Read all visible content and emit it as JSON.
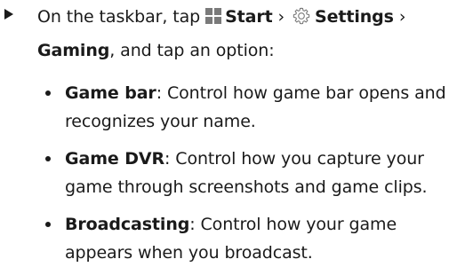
{
  "step": {
    "prefix": "On the taskbar, tap",
    "start_label": "Start",
    "separator1": " › ",
    "settings_label": "Settings",
    "separator2": " ›",
    "gaming_label": "Gaming",
    "suffix": ", and tap an option:"
  },
  "options": [
    {
      "name": "Game bar",
      "separator": ": ",
      "description": "Control how game bar opens and recognizes your name."
    },
    {
      "name": "Game DVR",
      "separator": ": ",
      "description": "Control how you capture your game through screenshots and game clips."
    },
    {
      "name": "Broadcasting",
      "separator": ": ",
      "description": "Control how your game appears when you broadcast."
    }
  ],
  "colors": {
    "text": "#1a1a1a",
    "icon": "#7a7a7a"
  },
  "icons": {
    "step_marker": "triangle-arrow-icon",
    "start": "windows-start-icon",
    "settings": "gear-icon",
    "bullet": "bullet-dot-icon"
  }
}
